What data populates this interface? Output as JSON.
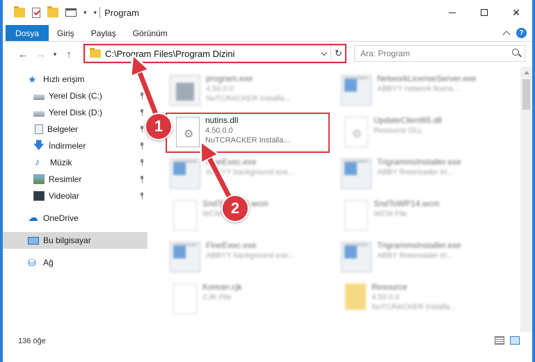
{
  "window": {
    "title": "Program"
  },
  "ribbon": {
    "tabs": [
      {
        "label": "Dosya"
      },
      {
        "label": "Giriş"
      },
      {
        "label": "Paylaş"
      },
      {
        "label": "Görünüm"
      }
    ],
    "help": "?"
  },
  "address": {
    "path": "C:\\Program Files\\Program Dizini",
    "refresh": "↻"
  },
  "search": {
    "placeholder": "Ara: Program"
  },
  "nav": {
    "items": [
      {
        "label": "Hızlı erişim",
        "icon": "star-icon"
      },
      {
        "label": "Yerel Disk (C:)",
        "icon": "disk-icon"
      },
      {
        "label": "Yerel Disk (D:)",
        "icon": "disk-icon"
      },
      {
        "label": "Belgeler",
        "icon": "documents-icon"
      },
      {
        "label": "İndirmeler",
        "icon": "downloads-icon"
      },
      {
        "label": "Müzik",
        "icon": "music-icon"
      },
      {
        "label": "Resimler",
        "icon": "pictures-icon"
      },
      {
        "label": "Videolar",
        "icon": "videos-icon"
      },
      {
        "label": "OneDrive",
        "icon": "cloud-icon"
      },
      {
        "label": "Bu bilgisayar",
        "icon": "computer-icon"
      },
      {
        "label": "Ağ",
        "icon": "network-icon"
      }
    ]
  },
  "files": [
    {
      "name": "program.exe",
      "sub1": "4.50.0.0",
      "sub2": "NuTCRACKER Installa..."
    },
    {
      "name": "NetworkLicenseServer.exe",
      "sub1": "ABBYY network licens...",
      "sub2": ""
    },
    {
      "name": "nutins.dll",
      "sub1": "4.50.0.0",
      "sub2": "NuTCRACKER Installa..."
    },
    {
      "name": "UpdateClient65.dll",
      "sub1": "Resource DLL",
      "sub2": ""
    },
    {
      "name": "FineExec.exe",
      "sub1": "ABBYY background exe...",
      "sub2": ""
    },
    {
      "name": "TrigrammsInstaller.exe",
      "sub1": "ABBY fineereader tri...",
      "sub2": ""
    },
    {
      "name": "SndToWP14.wcm",
      "sub1": "WCM File",
      "sub2": ""
    },
    {
      "name": "SndToWP14.wcm",
      "sub1": "WCM File",
      "sub2": ""
    },
    {
      "name": "FineExec.exe",
      "sub1": "ABBYY background exe...",
      "sub2": ""
    },
    {
      "name": "TrigrammsInstaller.exe",
      "sub1": "ABBY fineereader tri...",
      "sub2": ""
    },
    {
      "name": "Korean.cjk",
      "sub1": "CJK File",
      "sub2": ""
    },
    {
      "name": "Resource",
      "sub1": "4.50.0.0",
      "sub2": "NuTCRACKER Installa..."
    }
  ],
  "status": {
    "count": "136 öğe"
  },
  "annotations": {
    "badge1": "1",
    "badge2": "2"
  },
  "colors": {
    "accent": "#1979ca",
    "highlight": "#d9363e"
  }
}
